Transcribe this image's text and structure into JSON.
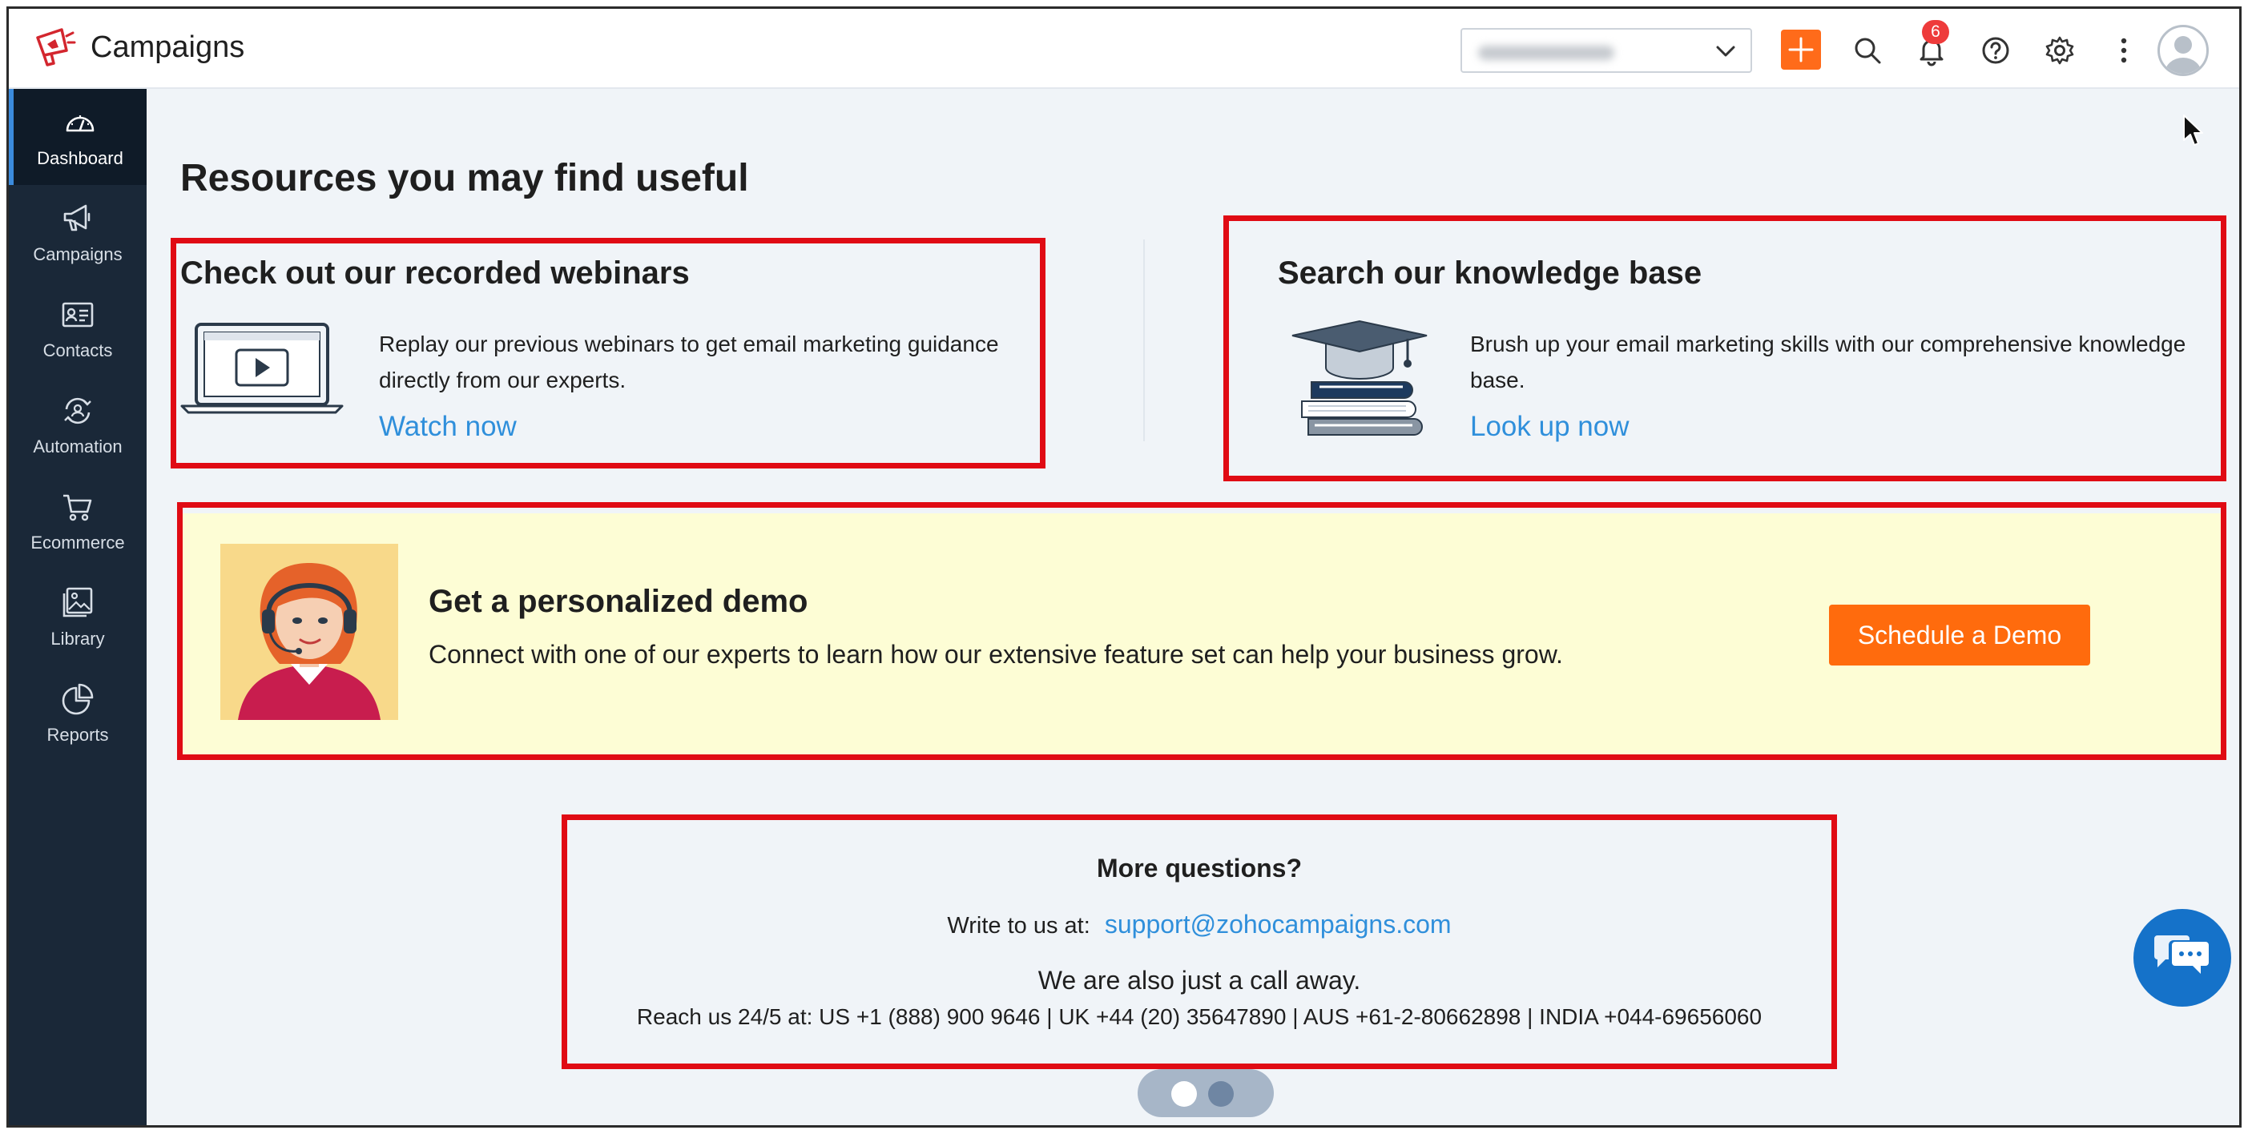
{
  "app": {
    "title": "Campaigns",
    "accent_color": "#ff6b1a",
    "link_color": "#2f8fdb",
    "highlight_color": "#e00b14"
  },
  "topbar": {
    "org_select_value": "",
    "notification_count": "6",
    "icons": [
      "add-icon",
      "search-icon",
      "bell-icon",
      "help-icon",
      "gear-icon",
      "more-vertical-icon",
      "avatar"
    ]
  },
  "sidebar": {
    "items": [
      {
        "label": "Dashboard",
        "icon": "dashboard-gauge-icon",
        "active": true
      },
      {
        "label": "Campaigns",
        "icon": "megaphone-icon",
        "active": false
      },
      {
        "label": "Contacts",
        "icon": "contact-card-icon",
        "active": false
      },
      {
        "label": "Automation",
        "icon": "automation-icon",
        "active": false
      },
      {
        "label": "Ecommerce",
        "icon": "cart-icon",
        "active": false
      },
      {
        "label": "Library",
        "icon": "library-image-icon",
        "active": false
      },
      {
        "label": "Reports",
        "icon": "pie-chart-icon",
        "active": false
      }
    ]
  },
  "resources": {
    "title": "Resources you may find useful",
    "webinars": {
      "title": "Check out our recorded webinars",
      "desc_line1": "Replay our previous webinars to get email marketing guidance",
      "desc_line2": "directly from our experts.",
      "link": "Watch now"
    },
    "knowledge": {
      "title": "Search our knowledge base",
      "desc_line1": "Brush up your email marketing skills with our comprehensive knowledge",
      "desc_line2": "base.",
      "link": "Look up now"
    }
  },
  "demo": {
    "title": "Get a personalized demo",
    "desc": "Connect with one of our experts to learn how our extensive feature set can help your business grow.",
    "button": "Schedule a Demo"
  },
  "questions": {
    "title": "More questions?",
    "write_label": "Write to us at:",
    "email": "support@zohocampaigns.com",
    "call_line": "We are also just a call away.",
    "reach_line": "Reach us 24/5 at: US +1 (888) 900 9646 | UK +44 (20) 35647890 | AUS +61-2-80662898 | INDIA +044-69656060"
  },
  "pager": {
    "count": 2,
    "active_index": 0
  }
}
